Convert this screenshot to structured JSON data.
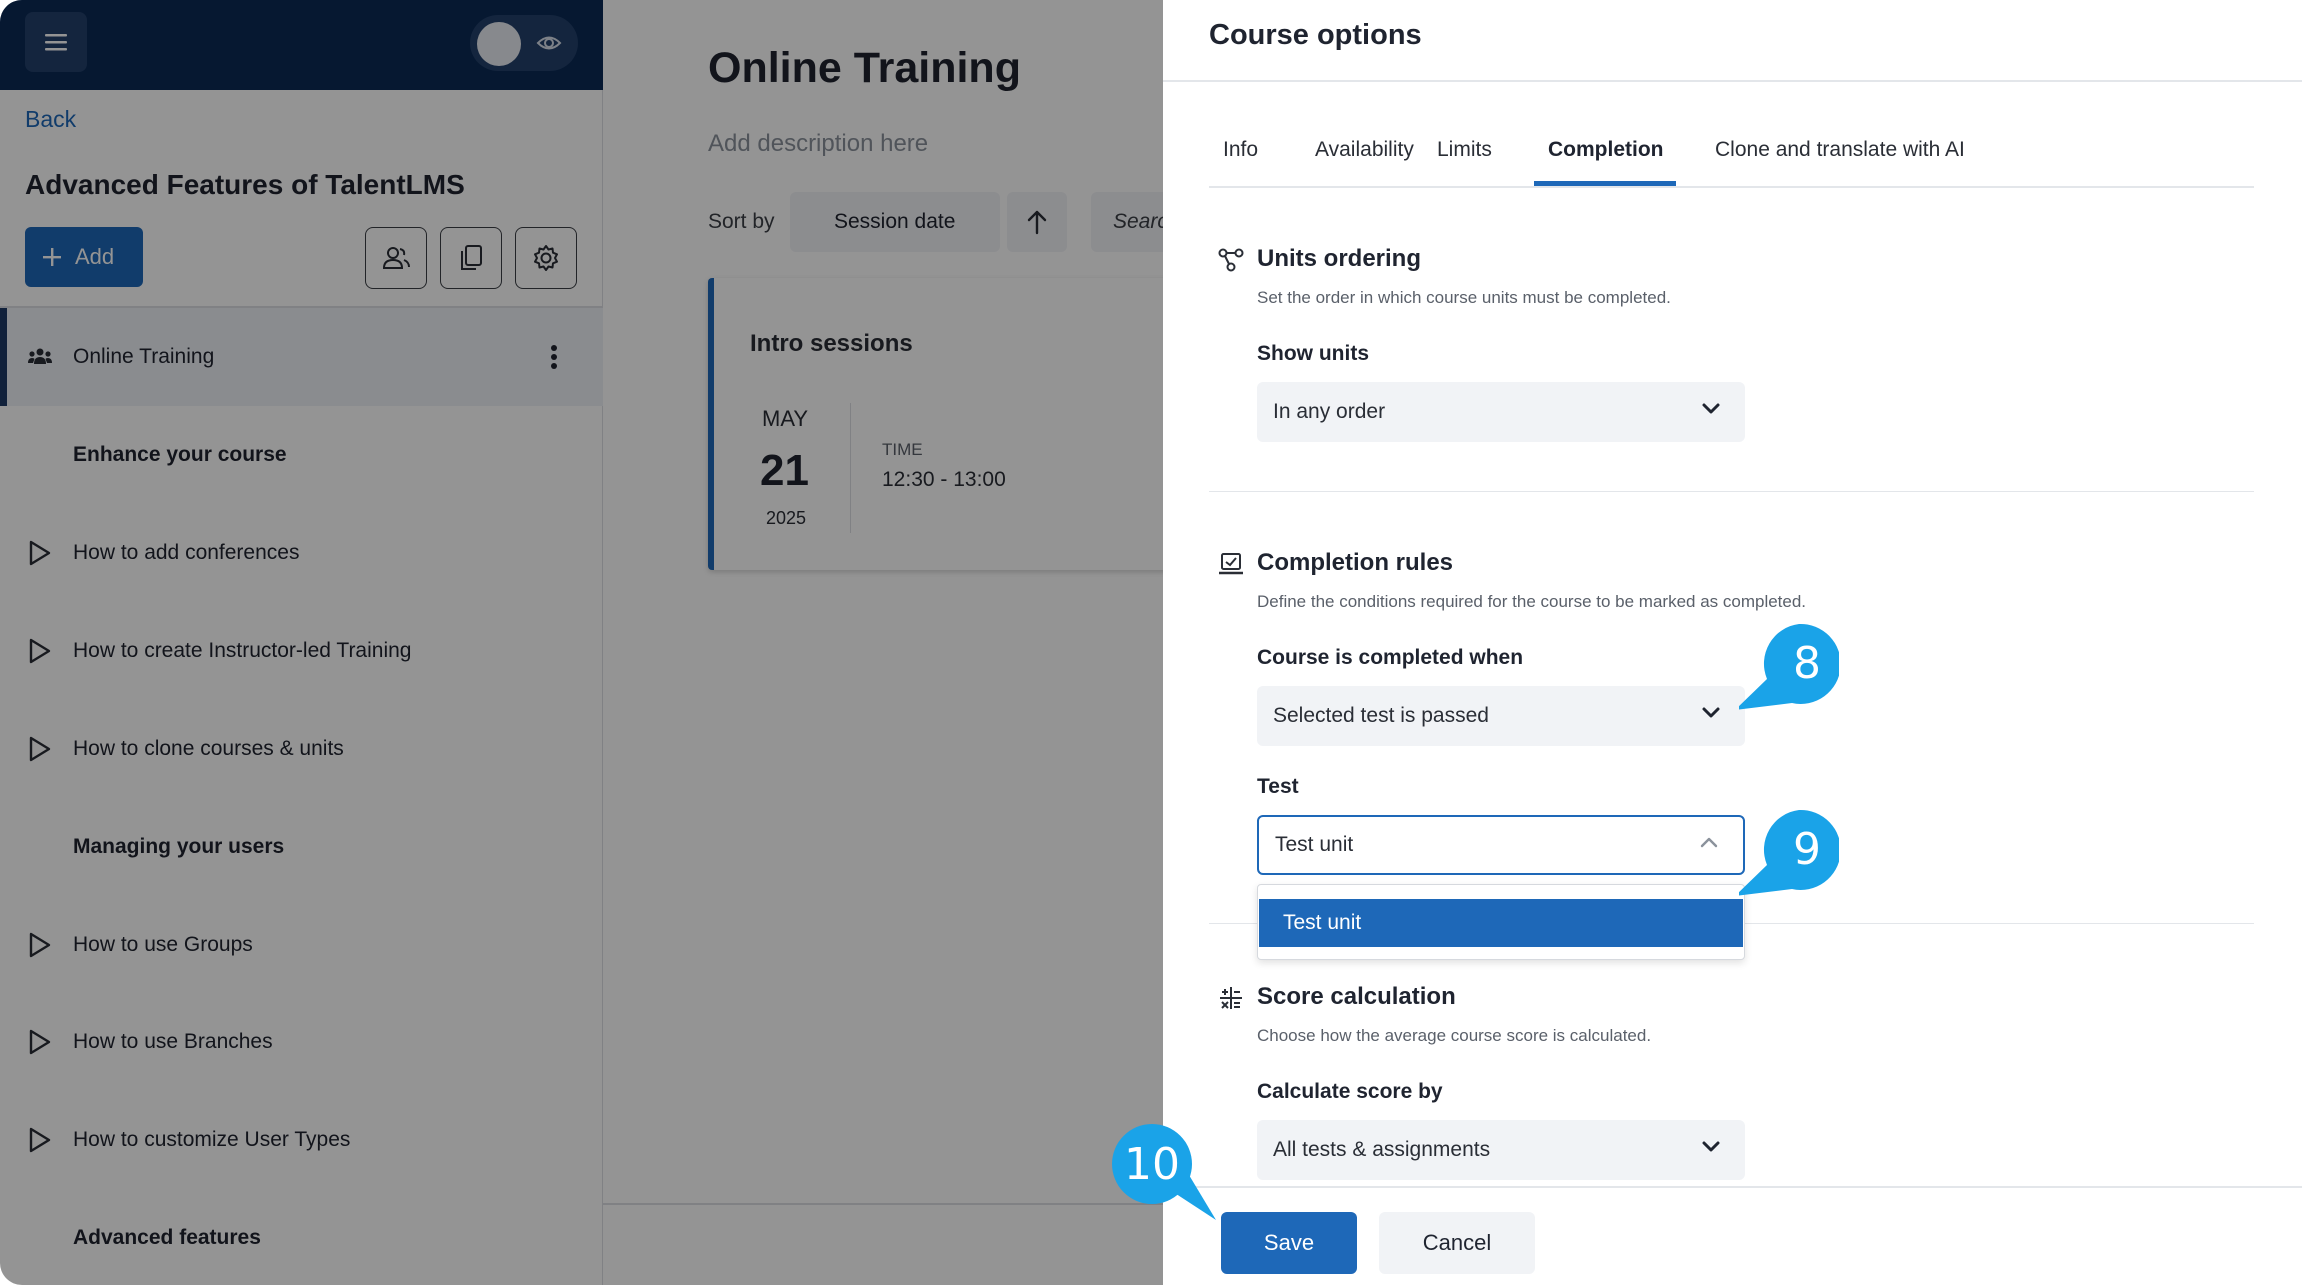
{
  "sidebar": {
    "back_label": "Back",
    "course_title": "Advanced Features of TalentLMS",
    "add_label": "Add",
    "items": [
      {
        "type": "unit",
        "label": "Online Training",
        "icon": "users-icon",
        "active": true
      },
      {
        "type": "section",
        "label": "Enhance your course"
      },
      {
        "type": "unit",
        "label": "How to add conferences",
        "icon": "play-icon"
      },
      {
        "type": "unit",
        "label": "How to create Instructor-led Training",
        "icon": "play-icon"
      },
      {
        "type": "unit",
        "label": "How to clone courses & units",
        "icon": "play-icon"
      },
      {
        "type": "section",
        "label": "Managing your users"
      },
      {
        "type": "unit",
        "label": "How to use Groups",
        "icon": "play-icon"
      },
      {
        "type": "unit",
        "label": "How to use Branches",
        "icon": "play-icon"
      },
      {
        "type": "unit",
        "label": "How to customize User Types",
        "icon": "play-icon"
      },
      {
        "type": "section",
        "label": "Advanced features"
      }
    ]
  },
  "content": {
    "title": "Online Training",
    "description_placeholder": "Add description here",
    "sort_label": "Sort by",
    "sort_value": "Session date",
    "search_placeholder": "Search",
    "card": {
      "title": "Intro sessions",
      "month": "MAY",
      "day": "21",
      "year": "2025",
      "time_label": "TIME",
      "time": "12:30 - 13:00"
    }
  },
  "drawer": {
    "title": "Course options",
    "tabs": [
      {
        "label": "Info",
        "active": false
      },
      {
        "label": "Availability",
        "active": false
      },
      {
        "label": "Limits",
        "active": false
      },
      {
        "label": "Completion",
        "active": true
      },
      {
        "label": "Clone and translate with AI",
        "active": false
      }
    ],
    "units_ordering": {
      "title": "Units ordering",
      "description": "Set the order in which course units must be completed.",
      "field_label": "Show units",
      "value": "In any order"
    },
    "completion_rules": {
      "title": "Completion rules",
      "description": "Define the conditions required for the course to be marked as completed.",
      "field_label": "Course is completed when",
      "value": "Selected test is passed",
      "test_label": "Test",
      "test_value": "Test unit",
      "test_options": [
        "Test unit"
      ]
    },
    "score_calculation": {
      "title": "Score calculation",
      "description": "Choose how the average course score is calculated.",
      "field_label": "Calculate score by",
      "value": "All tests & assignments"
    },
    "save_label": "Save",
    "cancel_label": "Cancel"
  },
  "callouts": [
    "8",
    "9",
    "10"
  ],
  "colors": {
    "primary": "#1e68b8",
    "topbar": "#0b2a55",
    "callout": "#1aa3e8"
  }
}
